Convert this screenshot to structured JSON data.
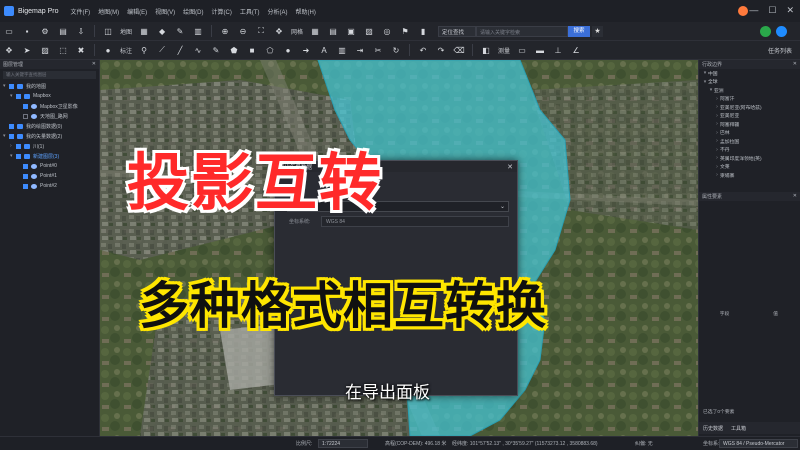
{
  "app": {
    "title": "Bigemap Pro"
  },
  "menu": [
    "文件(F)",
    "地图(M)",
    "编辑(E)",
    "视图(V)",
    "绘图(D)",
    "计算(C)",
    "工具(T)",
    "分析(A)",
    "帮助(H)"
  ],
  "window_controls": {
    "minimize": "—",
    "maximize": "☐",
    "close": "✕"
  },
  "toolbar1": {
    "map_label": "地图",
    "grid_label": "网格",
    "search_mode": "定位查找",
    "search_placeholder": "请输入关键字检索",
    "search_button": "搜索"
  },
  "toolbar2": {
    "annotate_label": "标注",
    "measure_label": "测量",
    "task_center": "任务列表"
  },
  "left_panel": {
    "title": "图层管理",
    "search_placeholder": "输入关键字查找图层",
    "items": [
      {
        "label": "我的地图",
        "checked": true,
        "level": 0,
        "expand": "▾"
      },
      {
        "label": "Mapbox",
        "checked": true,
        "level": 1,
        "expand": "▾"
      },
      {
        "label": "Mapbox卫星影像",
        "checked": true,
        "level": 2,
        "expand": ""
      },
      {
        "label": "天地图_路网",
        "checked": false,
        "level": 2,
        "expand": ""
      },
      {
        "label": "我的绘图数据(0)",
        "checked": true,
        "level": 0,
        "expand": ""
      },
      {
        "label": "我的矢量数据(2)",
        "checked": true,
        "level": 0,
        "expand": "▾"
      },
      {
        "label": "川(1)",
        "checked": true,
        "level": 1,
        "expand": "›"
      },
      {
        "label": "新建图层(3)",
        "checked": true,
        "level": 1,
        "expand": "▾",
        "selected": true
      },
      {
        "label": "Point#0",
        "checked": true,
        "level": 2,
        "expand": ""
      },
      {
        "label": "Point#1",
        "checked": true,
        "level": 2,
        "expand": ""
      },
      {
        "label": "Point#2",
        "checked": true,
        "level": 2,
        "expand": ""
      }
    ]
  },
  "right_panel": {
    "title": "行政边界",
    "tree": [
      {
        "label": "中国",
        "level": 0,
        "expand": "▾"
      },
      {
        "label": "全球",
        "level": 0,
        "expand": "▾"
      },
      {
        "label": "亚洲",
        "level": 1,
        "expand": "▾"
      },
      {
        "label": "阿富汗",
        "level": 2,
        "expand": "›"
      },
      {
        "label": "亚美尼亚(阿布哈兹)",
        "level": 2,
        "expand": "›"
      },
      {
        "label": "亚美尼亚",
        "level": 2,
        "expand": "›"
      },
      {
        "label": "阿塞拜疆",
        "level": 2,
        "expand": "›"
      },
      {
        "label": "巴林",
        "level": 2,
        "expand": "›"
      },
      {
        "label": "孟加拉国",
        "level": 2,
        "expand": "›"
      },
      {
        "label": "不丹",
        "level": 2,
        "expand": "›"
      },
      {
        "label": "英属印度洋领地(英)",
        "level": 2,
        "expand": "›"
      },
      {
        "label": "文莱",
        "level": 2,
        "expand": "›"
      },
      {
        "label": "柬埔寨",
        "level": 2,
        "expand": "›"
      }
    ],
    "attr_title": "属性要素",
    "col_field": "字段",
    "col_value": "值",
    "selected_count": "已选了0个要素"
  },
  "dialog": {
    "title": "导出矢量数据",
    "subtitle": "数据",
    "crs_label": "坐标系统:",
    "crs_value": "WGS 84",
    "close": "✕"
  },
  "overlay": {
    "main_caption": "投影互转",
    "sub_caption": "多种格式相互转换",
    "subtitle": "在导出面板"
  },
  "statusbar": {
    "scale_label": "比例尺:",
    "scale_value": "1:72224",
    "elevation": "高程(COP-DEM): 496.18 米",
    "coords": "经纬度: 101°57'52.13\" , 30°35'59.27\" (11573273.12 , 3580883.68)",
    "offset": "纠偏: 无",
    "crs_label": "坐标系:",
    "crs_value": "WGS 84 / Pseudo-Mercator",
    "tab_history": "历史数据",
    "tab_toolbox": "工具箱"
  },
  "colors": {
    "accent": "#3d8bfd",
    "polygon_fill": "#45c8d8",
    "main_caption": "#ff2a2a",
    "sub_caption_outline": "#ffe600"
  }
}
